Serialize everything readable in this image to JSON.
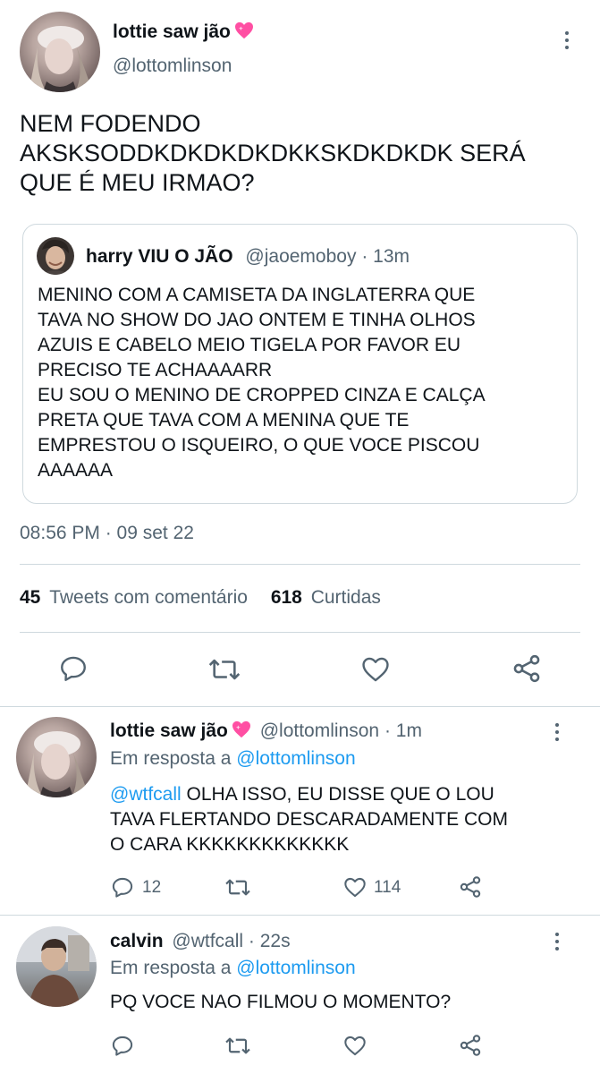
{
  "main_tweet": {
    "display_name": "lottie saw jão",
    "handle": "@lottomlinson",
    "text_lines": [
      "NEM FODENDO",
      "AKSKSODDKDKDKDKDKKSKDKDKDK SERÁ",
      "QUE É MEU IRMAO?"
    ],
    "timestamp": "08:56 PM · 09 set 22"
  },
  "quoted_tweet": {
    "display_name": "harry VIU O JÃO",
    "handle": "@jaoemoboy",
    "age": "· 13m",
    "text_lines": [
      "MENINO COM A CAMISETA DA INGLATERRA QUE",
      "TAVA NO SHOW DO JAO ONTEM E TINHA OLHOS",
      "AZUIS E CABELO MEIO TIGELA POR FAVOR EU",
      "PRECISO TE ACHAAAARR",
      "EU SOU O MENINO DE CROPPED CINZA E CALÇA",
      "PRETA QUE TAVA COM A MENINA QUE TE",
      "EMPRESTOU O ISQUEIRO, O QUE VOCE PISCOU",
      "AAAAAA"
    ]
  },
  "stats": {
    "comments_count": "45",
    "comments_label": "Tweets com comentário",
    "likes_count": "618",
    "likes_label": "Curtidas"
  },
  "replies": [
    {
      "display_name": "lottie saw jão",
      "handle": "@lottomlinson",
      "age": "· 1m",
      "reply_prefix": "Em resposta a",
      "reply_to": "@lottomlinson",
      "mention": "@wtfcall",
      "text_first": "OLHA ISSO, EU DISSE QUE O LOU",
      "text_lines": [
        "TAVA FLERTANDO DESCARADAMENTE COM",
        "O CARA KKKKKKKKKKKKK"
      ],
      "reply_count": "12",
      "like_count": "114"
    },
    {
      "display_name": "calvin",
      "handle": "@wtfcall",
      "age": "· 22s",
      "reply_prefix": "Em resposta a",
      "reply_to": "@lottomlinson",
      "text": "PQ VOCE NAO FILMOU O MOMENTO?"
    }
  ],
  "icons": {
    "reply": "reply-icon",
    "retweet": "retweet-icon",
    "like": "heart-icon",
    "share": "share-icon",
    "more": "more-icon",
    "emoji": "pink-heart-emoji"
  },
  "colors": {
    "text": "#0f1419",
    "muted": "#536471",
    "link": "#1d9bf0",
    "divider": "#cfd9de",
    "emoji_heart": "#ff4fa3"
  }
}
